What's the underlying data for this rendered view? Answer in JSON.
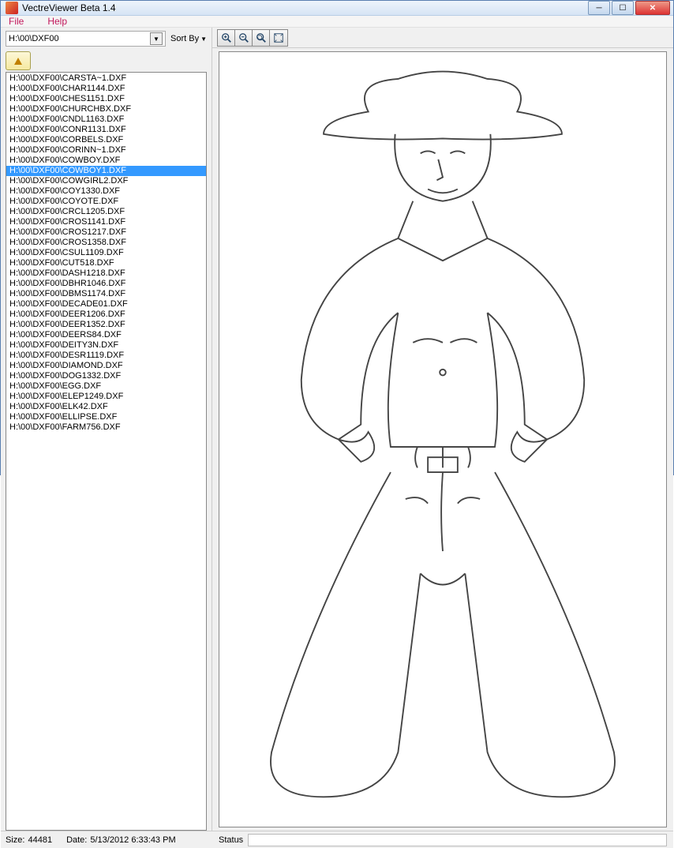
{
  "window": {
    "title": "VectreViewer Beta 1.4"
  },
  "menu": {
    "file": "File",
    "help": "Help"
  },
  "path": {
    "value": "H:\\00\\DXF00",
    "sortby_label": "Sort By"
  },
  "files": {
    "selected_index": 9,
    "items": [
      "H:\\00\\DXF00\\CARSTA~1.DXF",
      "H:\\00\\DXF00\\CHAR1144.DXF",
      "H:\\00\\DXF00\\CHES1151.DXF",
      "H:\\00\\DXF00\\CHURCHBX.DXF",
      "H:\\00\\DXF00\\CNDL1163.DXF",
      "H:\\00\\DXF00\\CONR1131.DXF",
      "H:\\00\\DXF00\\CORBELS.DXF",
      "H:\\00\\DXF00\\CORINN~1.DXF",
      "H:\\00\\DXF00\\COWBOY.DXF",
      "H:\\00\\DXF00\\COWBOY1.DXF",
      "H:\\00\\DXF00\\COWGIRL2.DXF",
      "H:\\00\\DXF00\\COY1330.DXF",
      "H:\\00\\DXF00\\COYOTE.DXF",
      "H:\\00\\DXF00\\CRCL1205.DXF",
      "H:\\00\\DXF00\\CROS1141.DXF",
      "H:\\00\\DXF00\\CROS1217.DXF",
      "H:\\00\\DXF00\\CROS1358.DXF",
      "H:\\00\\DXF00\\CSUL1109.DXF",
      "H:\\00\\DXF00\\CUT518.DXF",
      "H:\\00\\DXF00\\DASH1218.DXF",
      "H:\\00\\DXF00\\DBHR1046.DXF",
      "H:\\00\\DXF00\\DBMS1174.DXF",
      "H:\\00\\DXF00\\DECADE01.DXF",
      "H:\\00\\DXF00\\DEER1206.DXF",
      "H:\\00\\DXF00\\DEER1352.DXF",
      "H:\\00\\DXF00\\DEERS84.DXF",
      "H:\\00\\DXF00\\DEITY3N.DXF",
      "H:\\00\\DXF00\\DESR1119.DXF",
      "H:\\00\\DXF00\\DIAMOND.DXF",
      "H:\\00\\DXF00\\DOG1332.DXF",
      "H:\\00\\DXF00\\EGG.DXF",
      "H:\\00\\DXF00\\ELEP1249.DXF",
      "H:\\00\\DXF00\\ELK42.DXF",
      "H:\\00\\DXF00\\ELLIPSE.DXF",
      "H:\\00\\DXF00\\FARM756.DXF"
    ]
  },
  "status": {
    "size_label": "Size:",
    "size_value": "44481",
    "date_label": "Date:",
    "date_value": "5/13/2012 6:33:43 PM",
    "right_label": "Status"
  }
}
